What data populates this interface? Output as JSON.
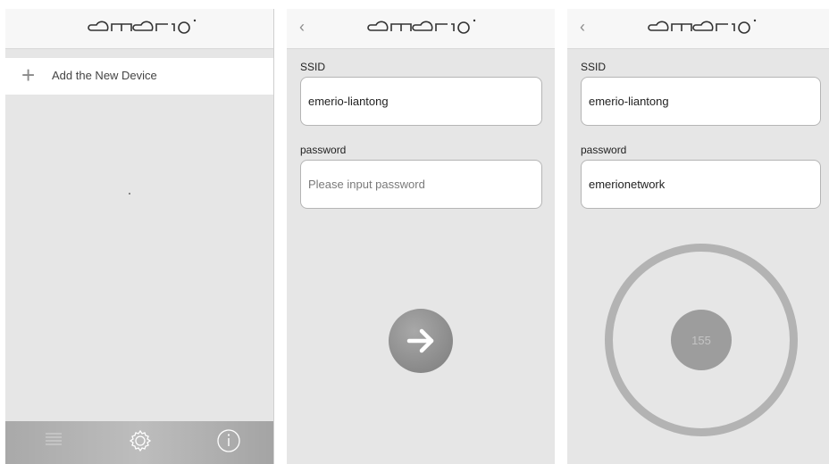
{
  "brand": {
    "logo_text": "emerio",
    "accent": "#8c8c8c"
  },
  "screen1": {
    "add_device_label": "Add the New Device",
    "tabs": [
      {
        "icon": "list-icon"
      },
      {
        "icon": "gear-icon"
      },
      {
        "icon": "info-icon"
      }
    ]
  },
  "screen2": {
    "back_label": "‹",
    "ssid_label": "SSID",
    "ssid_value": "emerio-liantong",
    "password_label": "password",
    "password_placeholder": "Please input password"
  },
  "screen3": {
    "back_label": "‹",
    "ssid_label": "SSID",
    "ssid_value": "emerio-liantong",
    "password_label": "password",
    "password_value": "emerionetwork",
    "countdown": "155"
  }
}
